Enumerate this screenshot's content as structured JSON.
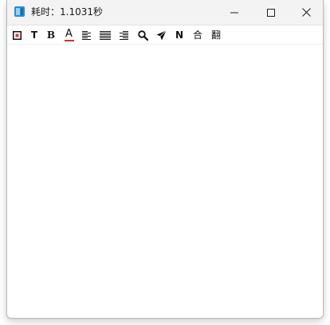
{
  "window": {
    "title": "耗时：1.1031秒"
  },
  "titlebar_buttons": {
    "minimize": "minimize-icon",
    "maximize": "maximize-icon",
    "close": "close-icon"
  },
  "toolbar": {
    "text_label": "T",
    "bold_label": "B",
    "font_color_label": "A",
    "normal_label": "N",
    "merge_label": "合",
    "translate_label": "翻",
    "colors": {
      "font_color_underline": "#d32f2f",
      "stop_square_outline": "#111111",
      "stop_square_fill": "#e53935"
    },
    "icons": [
      "stop-icon",
      "text-icon",
      "bold-icon",
      "font-color-icon",
      "align-left-icon",
      "align-justify-icon",
      "align-right-icon",
      "search-icon",
      "send-icon",
      "normal-icon",
      "merge-icon",
      "translate-icon"
    ]
  }
}
